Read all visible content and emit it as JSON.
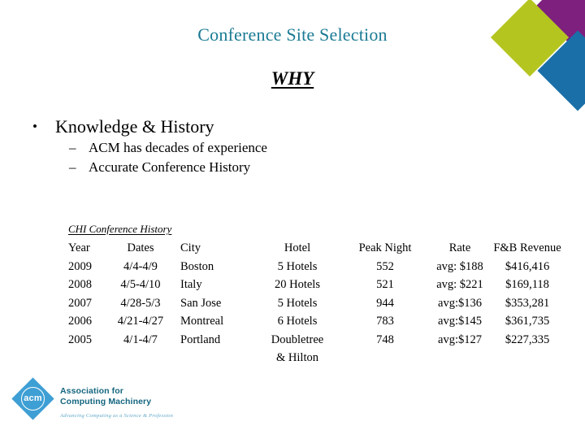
{
  "slide": {
    "title": "Conference Site Selection",
    "section_heading": "WHY"
  },
  "colors": {
    "title": "#1A7A94",
    "diamond_purple": "#7D207E",
    "diamond_green": "#B5C520",
    "diamond_blue": "#1A6FA8",
    "acm_blue": "#3E9FD4",
    "acm_text": "#14667F",
    "acm_tagline": "#5FA8C8"
  },
  "bullets": {
    "level1": {
      "marker": "•",
      "text": "Knowledge & History"
    },
    "level2": [
      {
        "marker": "–",
        "text": "ACM has decades of experience"
      },
      {
        "marker": "–",
        "text": "Accurate Conference History"
      }
    ]
  },
  "table": {
    "caption": "CHI Conference History",
    "headers": [
      "Year",
      "Dates",
      "City",
      "Hotel",
      "Peak Night",
      "Rate",
      "F&B Revenue"
    ],
    "rows": [
      {
        "year": "2009",
        "dates": "4/4-4/9",
        "city": "Boston",
        "hotel": "5 Hotels",
        "hotel_line2": "",
        "peak_night": "552",
        "rate": "avg: $188",
        "fb_revenue": "$416,416"
      },
      {
        "year": "2008",
        "dates": "4/5-4/10",
        "city": "Italy",
        "hotel": "20 Hotels",
        "hotel_line2": "",
        "peak_night": "521",
        "rate": "avg: $221",
        "fb_revenue": "$169,118"
      },
      {
        "year": "2007",
        "dates": "4/28-5/3",
        "city": "San Jose",
        "hotel": "5 Hotels",
        "hotel_line2": "",
        "peak_night": "944",
        "rate": "avg:$136",
        "fb_revenue": "$353,281"
      },
      {
        "year": "2006",
        "dates": "4/21-4/27",
        "city": "Montreal",
        "hotel": "6 Hotels",
        "hotel_line2": "",
        "peak_night": "783",
        "rate": "avg:$145",
        "fb_revenue": "$361,735"
      },
      {
        "year": "2005",
        "dates": "4/1-4/7",
        "city": "Portland",
        "hotel": "Doubletree",
        "hotel_line2": "& Hilton",
        "peak_night": "748",
        "rate": "avg:$127",
        "fb_revenue": "$227,335"
      }
    ]
  },
  "logo": {
    "mark_text": "acm",
    "name_line1": "Association for",
    "name_line2": "Computing Machinery",
    "tagline": "Advancing Computing as a Science & Profession"
  }
}
